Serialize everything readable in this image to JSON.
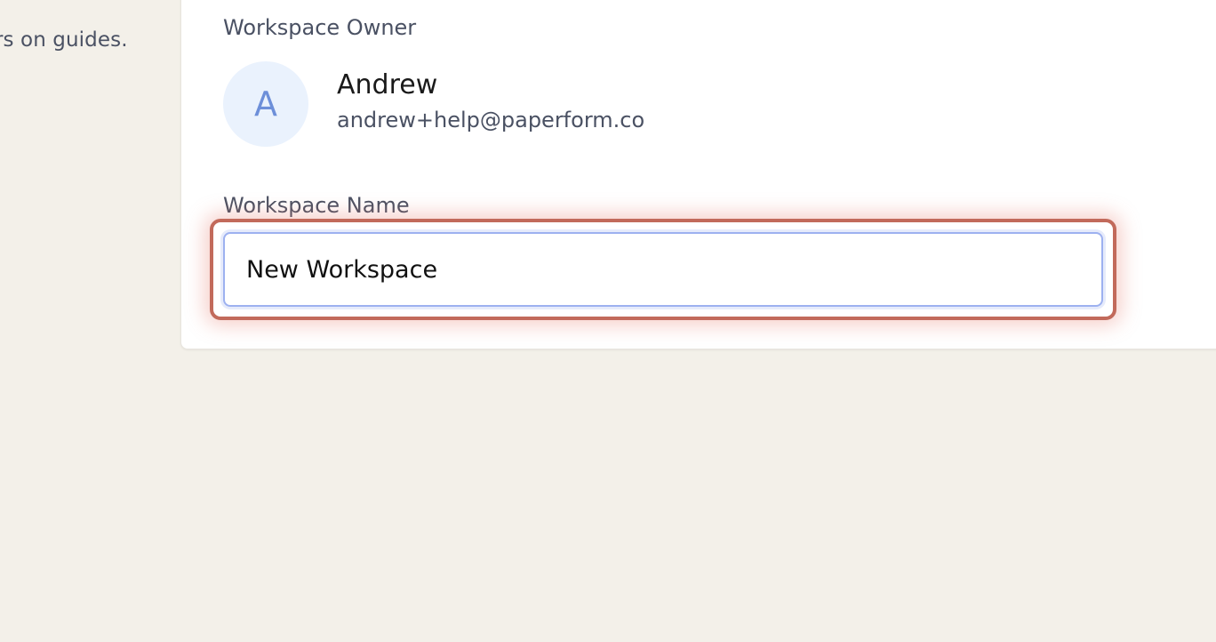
{
  "left_panel": {
    "description_fragment": "rs on guides."
  },
  "owner": {
    "label": "Workspace Owner",
    "avatar_initial": "A",
    "name": "Andrew",
    "email": "andrew+help@paperform.co"
  },
  "workspace_name": {
    "label": "Workspace Name",
    "value": "New Workspace"
  },
  "colors": {
    "background": "#f3f0e9",
    "card": "#ffffff",
    "avatar_bg": "#eaf2fd",
    "avatar_text": "#6d8fd9",
    "input_focus_border": "#9db1f0",
    "highlight_border": "#c26a5b"
  }
}
